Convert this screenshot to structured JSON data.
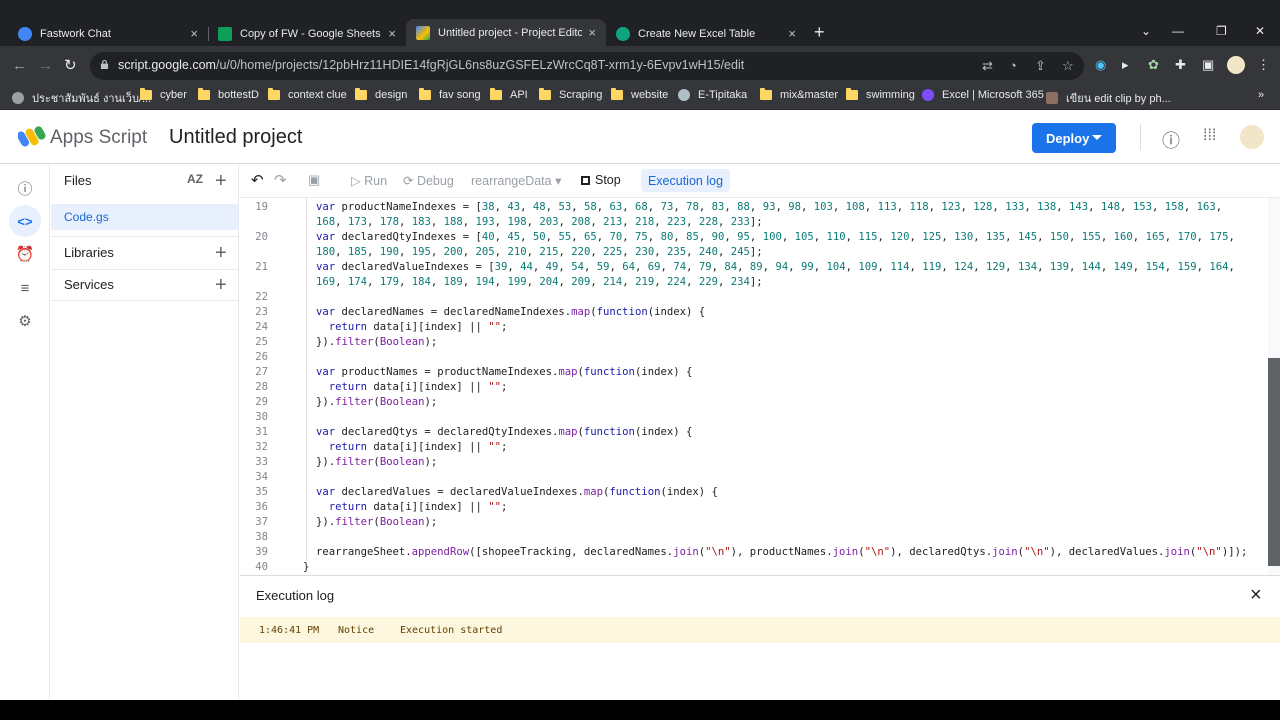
{
  "browser": {
    "tabs": [
      {
        "title": "Fastwork Chat",
        "close": "×"
      },
      {
        "title": "Copy of FW - Google Sheets",
        "close": "×"
      },
      {
        "title": "Untitled project - Project Editor -",
        "close": "×"
      },
      {
        "title": "Create New Excel Table",
        "close": "×"
      }
    ],
    "new_tab": "+",
    "url_host": "script.google.com",
    "url_path": "/u/0/home/projects/12pbHrz11HDIE14fgRjGL6ns8uzGSFELzWrcCq8T-xrm1y-6Evpv1wH15/edit",
    "bookmarks": [
      "ประชาสัมพันธ์ งานเว็บ/...",
      "cyber",
      "bottestD",
      "context clue",
      "design",
      "fav song",
      "API",
      "Scraping",
      "website",
      "E-Tipitaka",
      "mix&master",
      "swimming",
      "Excel | Microsoft 365",
      "เขียน edit clip by ph..."
    ],
    "bookmarks_more": "»"
  },
  "header": {
    "brand": "Apps Script",
    "project_title": "Untitled project",
    "deploy_label": "Deploy"
  },
  "files": {
    "heading": "Files",
    "sort_label": "AZ",
    "file": "Code.gs",
    "libraries": "Libraries",
    "services": "Services"
  },
  "toolbar": {
    "run": "Run",
    "debug": "Debug",
    "function": "rearrangeData",
    "stop": "Stop",
    "execution_log": "Execution log"
  },
  "code": {
    "lines": [
      {
        "n": "19",
        "text": "var productNameIndexes = [38, 43, 48, 53, 58, 63, 68, 73, 78, 83, 88, 93, 98, 103, 108, 113, 118, 123, 128, 133, 138, 143, 148, 153, 158, 163,"
      },
      {
        "n": "",
        "text": "168, 173, 178, 183, 188, 193, 198, 203, 208, 213, 218, 223, 228, 233];"
      },
      {
        "n": "20",
        "text": "var declaredQtyIndexes = [40, 45, 50, 55, 65, 70, 75, 80, 85, 90, 95, 100, 105, 110, 115, 120, 125, 130, 135, 145, 150, 155, 160, 165, 170, 175,"
      },
      {
        "n": "",
        "text": "180, 185, 190, 195, 200, 205, 210, 215, 220, 225, 230, 235, 240, 245];"
      },
      {
        "n": "21",
        "text": "var declaredValueIndexes = [39, 44, 49, 54, 59, 64, 69, 74, 79, 84, 89, 94, 99, 104, 109, 114, 119, 124, 129, 134, 139, 144, 149, 154, 159, 164,"
      },
      {
        "n": "",
        "text": "169, 174, 179, 184, 189, 194, 199, 204, 209, 214, 219, 224, 229, 234];"
      },
      {
        "n": "22",
        "text": ""
      },
      {
        "n": "23",
        "text": "var declaredNames = declaredNameIndexes.map(function(index) {"
      },
      {
        "n": "24",
        "text": "  return data[i][index] || \"\";"
      },
      {
        "n": "25",
        "text": "}).filter(Boolean);"
      },
      {
        "n": "26",
        "text": ""
      },
      {
        "n": "27",
        "text": "var productNames = productNameIndexes.map(function(index) {"
      },
      {
        "n": "28",
        "text": "  return data[i][index] || \"\";"
      },
      {
        "n": "29",
        "text": "}).filter(Boolean);"
      },
      {
        "n": "30",
        "text": ""
      },
      {
        "n": "31",
        "text": "var declaredQtys = declaredQtyIndexes.map(function(index) {"
      },
      {
        "n": "32",
        "text": "  return data[i][index] || \"\";"
      },
      {
        "n": "33",
        "text": "}).filter(Boolean);"
      },
      {
        "n": "34",
        "text": ""
      },
      {
        "n": "35",
        "text": "var declaredValues = declaredValueIndexes.map(function(index) {"
      },
      {
        "n": "36",
        "text": "  return data[i][index] || \"\";"
      },
      {
        "n": "37",
        "text": "}).filter(Boolean);"
      },
      {
        "n": "38",
        "text": ""
      },
      {
        "n": "39",
        "text": "rearrangeSheet.appendRow([shopeeTracking, declaredNames.join(\"\\n\"), productNames.join(\"\\n\"), declaredQtys.join(\"\\n\"), declaredValues.join(\"\\n\")]);"
      },
      {
        "n": "40",
        "text": "}"
      }
    ]
  },
  "log": {
    "title": "Execution log",
    "close": "×",
    "entries": [
      {
        "time": "1:46:41 PM",
        "level": "Notice",
        "message": "Execution started"
      }
    ]
  },
  "colors": {
    "accent": "#1a73e8",
    "notice_bg": "#fef7e0",
    "selected_file_bg": "#e8f0fe"
  }
}
